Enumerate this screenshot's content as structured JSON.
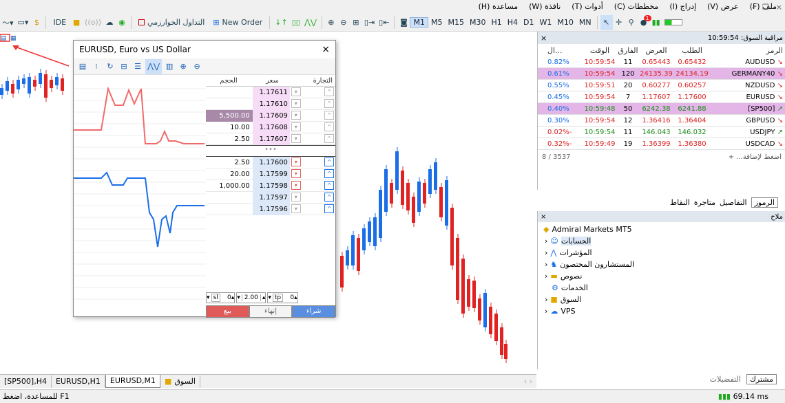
{
  "menu": [
    "ملف (F)",
    "عرض (V)",
    "إدراج (I)",
    "مخططات (C)",
    "أدوات (T)",
    "نافذة (W)",
    "مساعدة (H)"
  ],
  "toolbar": {
    "ide": "IDE",
    "algo_trading": "التداول الخوارزمي",
    "new_order": "New Order",
    "timeframes": [
      "M1",
      "M5",
      "M15",
      "M30",
      "H1",
      "H4",
      "D1",
      "W1",
      "M10",
      "MN"
    ],
    "active_tf": "M1",
    "notif_count": "1"
  },
  "chart_tabs": [
    "[SP500],H4",
    "EURUSD,H1",
    "EURUSD,M1",
    "السوق"
  ],
  "status": {
    "help": "للمساعدة، اضغط F1",
    "ping": "69.14 ms"
  },
  "dom": {
    "title": "EURUSD, Euro vs US Dollar",
    "headers": {
      "trade": "التجارة",
      "price": "سعر",
      "volume": "الحجم"
    },
    "rows": [
      {
        "vol": "",
        "price": "1.17611",
        "side": "ask"
      },
      {
        "vol": "",
        "price": "1.17610",
        "side": "ask"
      },
      {
        "vol": "5,500.00",
        "price": "1.17609",
        "side": "ask",
        "big": true
      },
      {
        "vol": "10.00",
        "price": "1.17608",
        "side": "ask"
      },
      {
        "vol": "2.50",
        "price": "1.17607",
        "side": "ask"
      },
      {
        "vol": "•••",
        "price": "",
        "side": "mid"
      },
      {
        "vol": "2.50",
        "price": "1.17600",
        "side": "bid"
      },
      {
        "vol": "20.00",
        "price": "1.17599",
        "side": "bid"
      },
      {
        "vol": "1,000.00",
        "price": "1.17598",
        "side": "bid"
      },
      {
        "vol": "",
        "price": "1.17597",
        "side": "bid"
      },
      {
        "vol": "",
        "price": "1.17596",
        "side": "bid"
      }
    ],
    "sl_label": "sl",
    "sl_value": "0",
    "volume": "2.00",
    "tp_label": "tp",
    "tp_value": "0",
    "sell": "بيع",
    "close": "إنهاء",
    "buy": "شراء",
    "colors": {
      "ask": "#f6dcf6",
      "bid": "#dce8f8",
      "ask_line": "#f26a6a",
      "bid_line": "#1a6ee8"
    }
  },
  "market_watch": {
    "title": "مراقبة السوق: 10:59:54",
    "headers": {
      "symbol": "الرمز",
      "bid": "الطلب",
      "ask": "العرض",
      "spread": "الفارق",
      "time": "الوقت",
      "change": "...ال"
    },
    "rows": [
      {
        "sym": "AUDUSD",
        "bid": "0.65432",
        "ask": "0.65443",
        "spread": "11",
        "time": "10:59:54",
        "chg": "0.82%",
        "dir": "down",
        "hl": false
      },
      {
        "sym": "GERMANY40",
        "bid": "24134.19",
        "ask": "24135.39",
        "spread": "120",
        "time": "10:59:54",
        "chg": "0.61%",
        "dir": "down",
        "hl": true
      },
      {
        "sym": "NZDUSD",
        "bid": "0.60257",
        "ask": "0.60277",
        "spread": "20",
        "time": "10:59:51",
        "chg": "0.55%",
        "dir": "down",
        "hl": false
      },
      {
        "sym": "EURUSD",
        "bid": "1.17600",
        "ask": "1.17607",
        "spread": "7",
        "time": "10:59:54",
        "chg": "0.45%",
        "dir": "down",
        "hl": false
      },
      {
        "sym": "[SP500]",
        "bid": "6241.88",
        "ask": "6242.38",
        "spread": "50",
        "time": "10:59:48",
        "chg": "0.40%",
        "dir": "up",
        "hl": true
      },
      {
        "sym": "GBPUSD",
        "bid": "1.36404",
        "ask": "1.36416",
        "spread": "12",
        "time": "10:59:54",
        "chg": "0.30%",
        "dir": "down",
        "hl": false
      },
      {
        "sym": "USDJPY",
        "bid": "146.032",
        "ask": "146.043",
        "spread": "11",
        "time": "10:59:54",
        "chg": "-0.02%",
        "dir": "up",
        "hl": false
      },
      {
        "sym": "USDCAD",
        "bid": "1.36380",
        "ask": "1.36399",
        "spread": "19",
        "time": "10:59:49",
        "chg": "-0.32%",
        "dir": "down",
        "hl": false
      }
    ],
    "add": "+ ...اضغط لإضافة",
    "count": "8 / 3537",
    "tabs": [
      "الرموز",
      "التفاصيل",
      "متاجرة",
      "النقاط"
    ]
  },
  "navigator": {
    "title": "ملاح",
    "root": "Admiral Markets MT5",
    "items": [
      "الحسابات",
      "المؤشرات",
      "المستشارون المختصون",
      "نصوص",
      "الخدمات",
      "السوق",
      "VPS"
    ],
    "tabs": [
      "مشترك",
      "التفضيلات"
    ]
  }
}
